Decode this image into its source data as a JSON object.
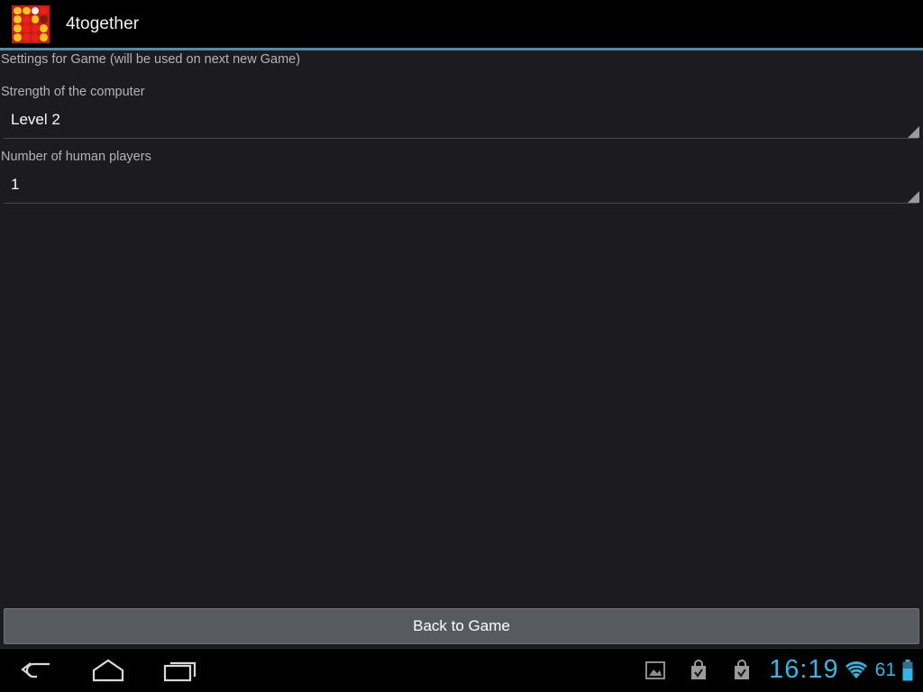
{
  "app": {
    "title": "4together",
    "icon_name": "connect-four-app-icon",
    "icon_grid": [
      [
        "y",
        "y",
        "w",
        "r"
      ],
      [
        "y",
        "r",
        "y",
        "e"
      ],
      [
        "y",
        "r",
        "r",
        "y"
      ],
      [
        "y",
        "r",
        "r",
        "y"
      ]
    ]
  },
  "colors": {
    "accent_blue": "#33b5e5",
    "title_rule": "#3a92c4",
    "background": "#1b1b20",
    "button_fill": "#575b60",
    "icon_red": "#cc1b13",
    "icon_yellow": "#f5c518"
  },
  "settings": {
    "header": "Settings for Game (will be used on next new Game)",
    "preferences": [
      {
        "label": "Strength of the computer",
        "value": "Level 2",
        "control": "spinner"
      },
      {
        "label": "Number of human players",
        "value": "1",
        "control": "spinner"
      }
    ]
  },
  "footer": {
    "back_button_label": "Back to Game"
  },
  "navbar": {
    "buttons": [
      {
        "name": "back",
        "icon": "back-arrow-icon"
      },
      {
        "name": "home",
        "icon": "home-icon"
      },
      {
        "name": "recents",
        "icon": "recent-apps-icon"
      }
    ],
    "status": {
      "notifications": [
        {
          "name": "gallery",
          "icon": "image-icon"
        },
        {
          "name": "play-store-download-1",
          "icon": "shopping-bag-check-icon"
        },
        {
          "name": "play-store-download-2",
          "icon": "shopping-bag-check-icon"
        }
      ],
      "clock": "16:19",
      "wifi_icon": "wifi-icon",
      "battery_level": "61",
      "battery_icon": "battery-icon"
    }
  }
}
